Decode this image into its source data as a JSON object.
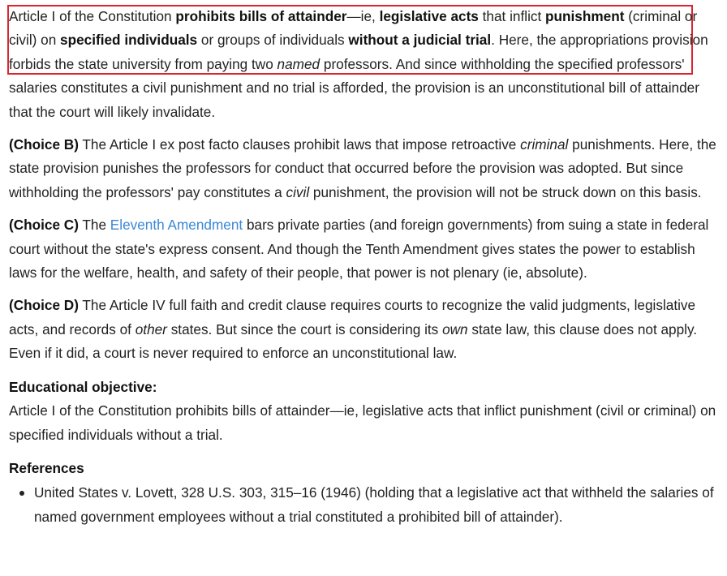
{
  "explanation": {
    "intro": {
      "t1": "Article I of the Constitution ",
      "b1": "prohibits bills of attainder",
      "t2": "—ie, ",
      "b2": "legislative acts",
      "t3": " that inflict ",
      "b3": "punishment",
      "t4": " (criminal or civil) on ",
      "b4": "specified individuals",
      "t5": " or groups of individuals ",
      "b5": "without a judicial trial",
      "t6": ".  Here, the appropriations provision forbids the state university from paying two ",
      "i1": "named",
      "t7": " professors.  And since withholding the specified professors' salaries constitutes a civil punishment and no trial is afforded, the provision is an unconstitutional bill of attainder that the court will likely invalidate."
    },
    "choice_b": {
      "label": "(Choice B)",
      "t1": "  The Article I ex post facto clauses prohibit laws that impose retroactive ",
      "i1": "criminal",
      "t2": " punishments.  Here, the state provision punishes the professors for conduct that occurred before the provision was adopted.  But since withholding the professors' pay constitutes a ",
      "i2": "civil",
      "t3": " punishment, the provision will not be struck down on this basis."
    },
    "choice_c": {
      "label": "(Choice C)",
      "t1": "  The ",
      "link": "Eleventh Amendment",
      "t2": " bars private parties (and foreign governments) from suing a state in federal court without the state's express consent.  And though the Tenth Amendment gives states the power to establish laws for the welfare, health, and safety of their people, that power is not plenary (ie, absolute)."
    },
    "choice_d": {
      "label": "(Choice D)",
      "t1": "  The Article IV full faith and credit clause requires courts to recognize the valid judgments, legislative acts, and records of ",
      "i1": "other",
      "t2": " states.  But since the court is considering its ",
      "i2": "own",
      "t3": " state law, this clause does not apply.  Even if it did, a court is never required to enforce an unconstitutional law."
    },
    "educational_objective": {
      "heading": "Educational objective:",
      "text": "Article I of the Constitution prohibits bills of attainder—ie, legislative acts that inflict punishment (civil or criminal) on specified individuals without a trial."
    },
    "references": {
      "heading": "References",
      "items": [
        "United States v. Lovett, 328 U.S. 303, 315–16 (1946) (holding that a legislative act that withheld the salaries of named government employees without a trial constituted a prohibited bill of attainder)."
      ]
    }
  },
  "colors": {
    "highlight_border": "#d9262e",
    "link": "#3b87d6",
    "text": "#222222"
  }
}
